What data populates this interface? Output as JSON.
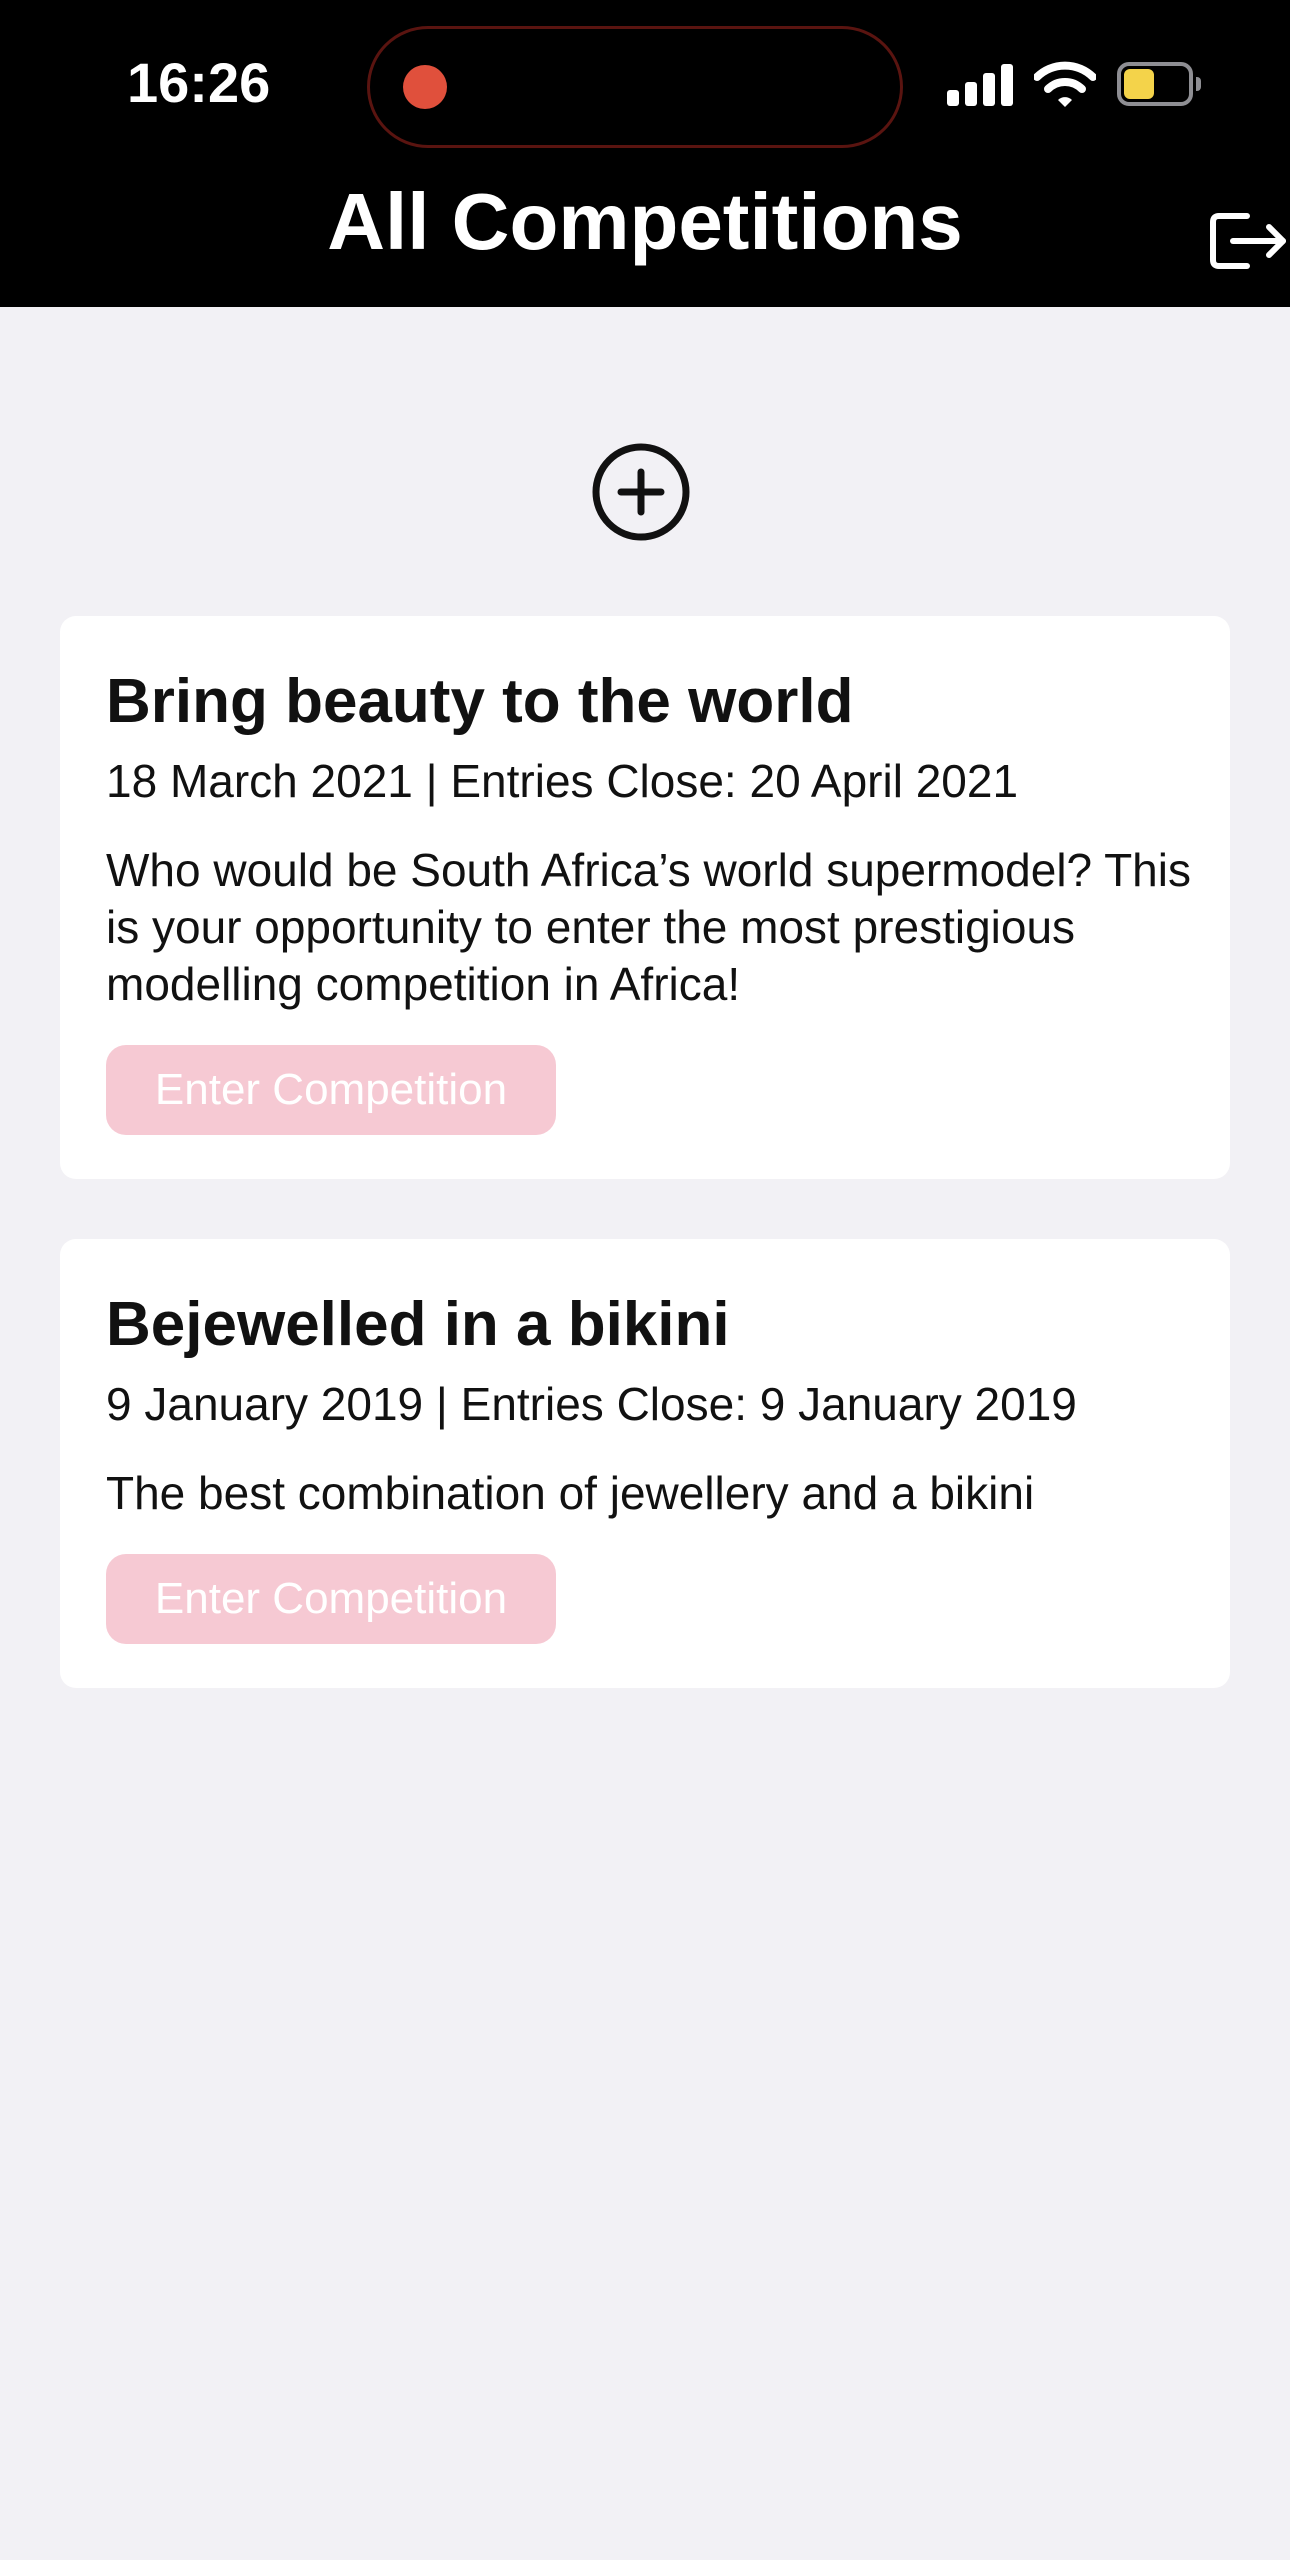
{
  "status_bar": {
    "time": "16:26"
  },
  "header": {
    "title": "All Competitions",
    "logout_icon": "logout-icon"
  },
  "add_button": {
    "icon": "plus-circle-icon"
  },
  "competitions": [
    {
      "title": "Bring beauty to the world",
      "dates": "18 March 2021 | Entries Close: 20 April 2021",
      "description": "Who would be South Africa’s world supermodel? This is your opportunity to enter the most prestigious modelling competition in Africa!",
      "button_label": "Enter Competition"
    },
    {
      "title": "Bejewelled in a bikini",
      "dates": "9 January 2019 | Entries Close: 9 January 2019",
      "description": "The best combination of jewellery and a bikini",
      "button_label": "Enter Competition"
    }
  ],
  "colors": {
    "header_bg": "#000000",
    "page_bg": "#f2f1f5",
    "card_bg": "#ffffff",
    "button_bg": "#f6c9d3",
    "button_text": "#ffffff",
    "recording_dot": "#e0503c",
    "battery_fill": "#f4d34a"
  }
}
